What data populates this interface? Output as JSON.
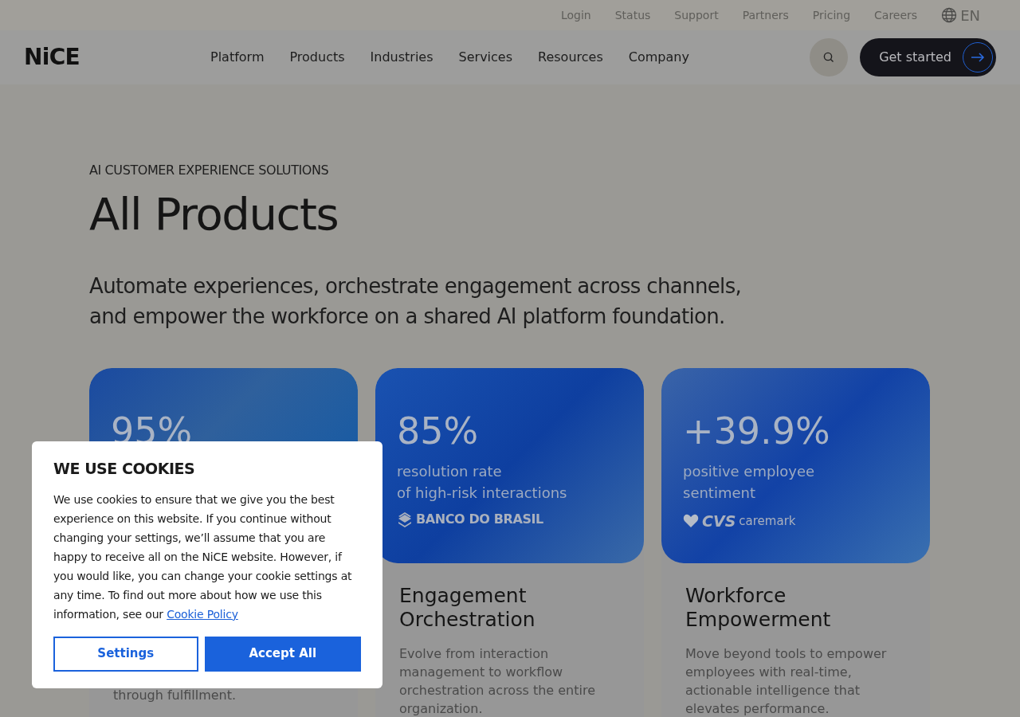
{
  "utility_nav": {
    "links": [
      "Login",
      "Status",
      "Support",
      "Partners",
      "Pricing",
      "Careers"
    ],
    "language": "EN"
  },
  "header": {
    "logo": "NiCE",
    "menu": [
      "Platform",
      "Products",
      "Industries",
      "Services",
      "Resources",
      "Company"
    ],
    "cta": "Get started"
  },
  "hero": {
    "eyebrow": "AI CUSTOMER EXPERIENCE SOLUTIONS",
    "title": "All Products",
    "subtitle": "Automate experiences, orchestrate engagement across channels, and empower the workforce on a shared AI platform foundation."
  },
  "cards": [
    {
      "stat": "95%",
      "description": "through fulfillment."
    },
    {
      "stat": "85%",
      "stat_lines": [
        "resolution rate",
        "of high-risk interactions"
      ],
      "logo": {
        "kind": "bank",
        "parts": [
          "BANCO DO BRASIL"
        ]
      },
      "title": "Engagement Orchestration",
      "description": "Evolve from interaction management to workflow orchestration across the entire organization."
    },
    {
      "stat": "+39.9%",
      "stat_lines": [
        "positive employee",
        "sentiment"
      ],
      "logo": {
        "kind": "pharmacy",
        "parts": [
          "CVS",
          "caremark"
        ]
      },
      "title": "Workforce Empowerment",
      "description": "Move beyond tools to empower employees with real-time, actionable intelligence that elevates performance."
    }
  ],
  "cookie_dialog": {
    "title": "WE USE COOKIES",
    "body": "We use cookies to ensure that we give you the best experience on this website. If you continue without changing your settings, we’ll assume that you are happy to receive all on the NiCE website. However, if you would like, you can change your cookie settings at any time. To find out more about how we use this information, see our",
    "link": "Cookie Policy",
    "buttons": [
      {
        "label": "Settings",
        "kind": "secondary"
      },
      {
        "label": "Accept All",
        "kind": "primary"
      }
    ]
  }
}
